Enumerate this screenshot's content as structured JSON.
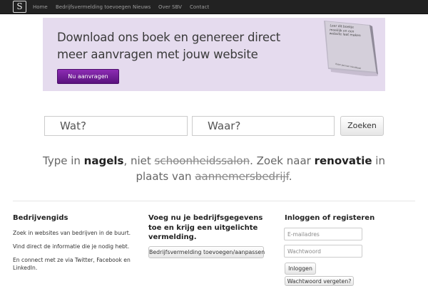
{
  "navbar": {
    "logo_glyph": "S",
    "links": [
      "Home",
      "Bedrijfsvermelding toevoegen",
      "Nieuws",
      "Over SBV",
      "Contact"
    ]
  },
  "banner": {
    "headline_line1": "Download ons boek en genereer direct",
    "headline_line2": "meer aanvragen met jouw website",
    "button_label": "Nu aanvragen",
    "book_title": "Leer dit boekje moeilijk en een website laat maken",
    "book_author": "Peter Janssen Handbook"
  },
  "search": {
    "what_placeholder": "Wat?",
    "where_placeholder": "Waar?",
    "button_label": "Zoeken"
  },
  "hint": {
    "part1": "Type in ",
    "term1": "nagels",
    "part2": ", niet ",
    "strike1": "schoonheidssalon",
    "part3": ". Zoek naar ",
    "term2": "renovatie",
    "part4": " in plaats van ",
    "strike2": "aannemersbedrijf",
    "part5": "."
  },
  "bedrijvengids": {
    "title": "Bedrijvengids",
    "lines": [
      "Zoek in websites van bedrijven in de buurt.",
      "Vind direct de informatie die je nodig hebt.",
      "En connect met ze via Twitter, Facebook en LinkedIn."
    ]
  },
  "add_listing": {
    "title": "Voeg nu je bedrijfsgegevens toe en krijg een uitgelichte vermelding.",
    "button_label": "Bedrijfsvermelding toevoegen/aanpassen"
  },
  "login": {
    "title": "Inloggen of registeren",
    "email_placeholder": "E-mailadres",
    "password_placeholder": "Wachtwoord",
    "login_button": "Inloggen",
    "forgot_button": "Wachtwoord vergeten?"
  },
  "colors": {
    "navbar_bg": "#222222",
    "banner_bg": "#e5dbee",
    "accent_purple": "#6a1b91"
  }
}
